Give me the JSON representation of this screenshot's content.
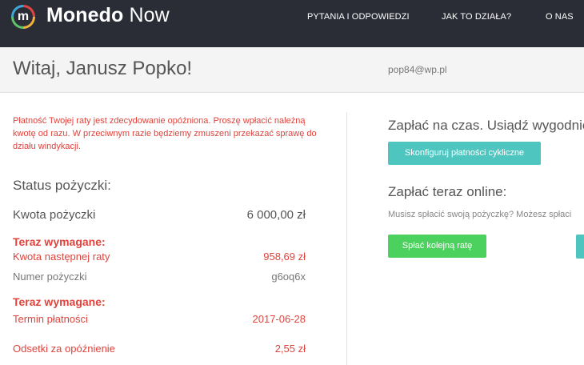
{
  "nav": {
    "brand_bold": "Monedo",
    "brand_light": "Now",
    "logo_letter": "m",
    "links": [
      "PYTANIA I ODPOWIEDZI",
      "JAK TO DZIAŁA?",
      "O NAS"
    ]
  },
  "header": {
    "greeting": "Witaj, Janusz Popko!",
    "email": "pop84@wp.pl"
  },
  "loan": {
    "warning": "Płatność Twojej raty jest zdecydowanie opóźniona. Proszę wpłacić należną kwotę od razu. W przeciwnym razie będziemy zmuszeni przekazać sprawę do działu windykacji.",
    "status_title": "Status pożyczki:",
    "amount_label": "Kwota pożyczki",
    "amount_value": "6 000,00 zł",
    "required_1": "Teraz wymagane:",
    "next_installment_label": "Kwota następnej raty",
    "next_installment_value": "958,69 zł",
    "loan_number_label": "Numer pożyczki",
    "loan_number_value": "g6oq6x",
    "required_2": "Teraz wymagane:",
    "due_date_label": "Termin płatności",
    "due_date_value": "2017-06-28",
    "interest_label": "Odsetki za opóźnienie",
    "interest_value": "2,55 zł"
  },
  "right": {
    "title_1": "Zapłać na czas. Usiądź wygodnie",
    "btn_recurring": "Skonfiguruj płatności cykliczne",
    "title_2": "Zapłać teraz online:",
    "note": "Musisz spłacić swoją pożyczkę? Możesz spłaci",
    "btn_pay": "Spłać kolejną ratę"
  },
  "colors": {
    "nav_bg": "#2b2d36",
    "alert_red": "#e0433c",
    "teal": "#4fc5c0",
    "green": "#4cd15e"
  }
}
